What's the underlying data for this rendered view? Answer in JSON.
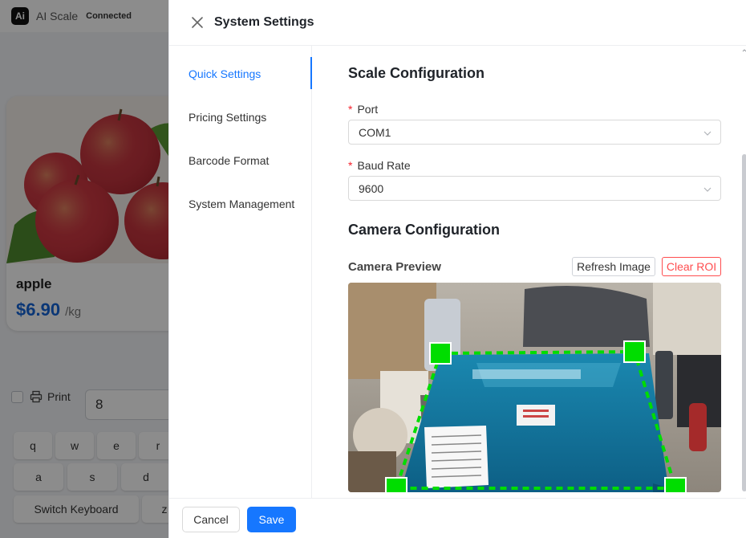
{
  "app": {
    "logo": "Ai",
    "name": "AI Scale",
    "status": "Connected"
  },
  "product": {
    "name": "apple",
    "price": "$6.90",
    "unit": "/kg"
  },
  "print": {
    "label": "Print",
    "quantity": "8"
  },
  "keyboard": {
    "row1": [
      "q",
      "w",
      "e",
      "r"
    ],
    "row2": [
      "a",
      "s",
      "d"
    ],
    "switch_label": "Switch Keyboard",
    "partial_key": "z"
  },
  "drawer": {
    "title": "System Settings",
    "nav": [
      {
        "label": "Quick Settings",
        "active": true
      },
      {
        "label": "Pricing Settings",
        "active": false
      },
      {
        "label": "Barcode Format",
        "active": false
      },
      {
        "label": "System Management",
        "active": false
      }
    ],
    "scale_config": {
      "title": "Scale Configuration",
      "port_label": "Port",
      "port_value": "COM1",
      "baud_label": "Baud Rate",
      "baud_value": "9600"
    },
    "camera_config": {
      "title": "Camera Configuration",
      "preview_label": "Camera Preview",
      "refresh_label": "Refresh Image",
      "clear_label": "Clear ROI"
    },
    "footer": {
      "cancel_label": "Cancel",
      "save_label": "Save"
    }
  },
  "colors": {
    "accent": "#1677ff",
    "danger": "#ff4d4f",
    "roi": "#00dd00",
    "price": "#1565d8"
  },
  "icons": {
    "close": "close-icon",
    "chevron": "chevron-down-icon",
    "printer": "printer-icon"
  }
}
